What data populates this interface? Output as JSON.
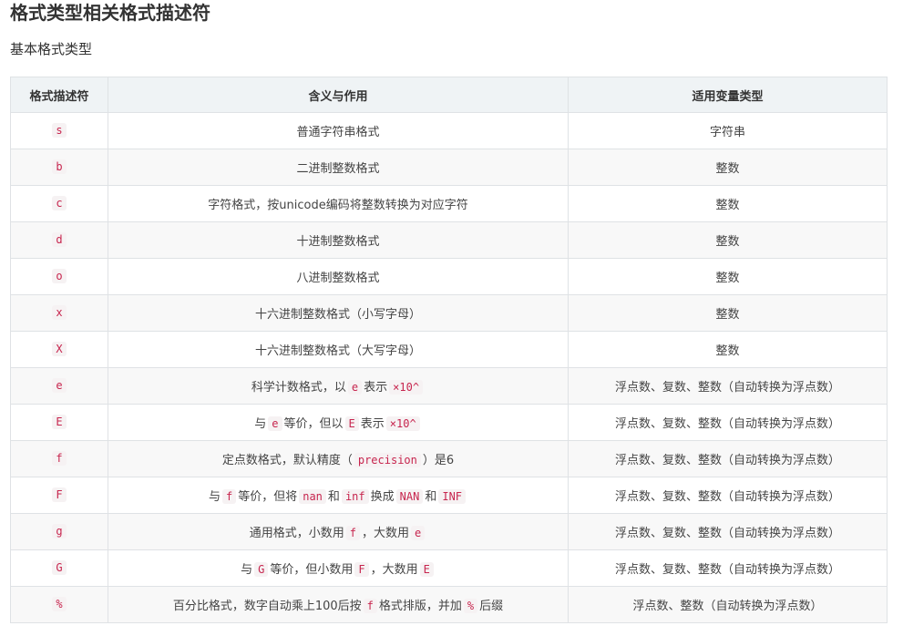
{
  "page": {
    "title": "格式类型相关格式描述符",
    "subtitle": "基本格式类型"
  },
  "table": {
    "headers": [
      "格式描述符",
      "含义与作用",
      "适用变量类型"
    ],
    "rows": [
      {
        "code": "s",
        "desc": [
          {
            "t": "普通字符串格式"
          }
        ],
        "type": "字符串"
      },
      {
        "code": "b",
        "desc": [
          {
            "t": "二进制整数格式"
          }
        ],
        "type": "整数"
      },
      {
        "code": "c",
        "desc": [
          {
            "t": "字符格式，按unicode编码将整数转换为对应字符"
          }
        ],
        "type": "整数"
      },
      {
        "code": "d",
        "desc": [
          {
            "t": "十进制整数格式"
          }
        ],
        "type": "整数"
      },
      {
        "code": "o",
        "desc": [
          {
            "t": "八进制整数格式"
          }
        ],
        "type": "整数"
      },
      {
        "code": "x",
        "desc": [
          {
            "t": "十六进制整数格式（小写字母）"
          }
        ],
        "type": "整数"
      },
      {
        "code": "X",
        "desc": [
          {
            "t": "十六进制整数格式（大写字母）"
          }
        ],
        "type": "整数"
      },
      {
        "code": "e",
        "desc": [
          {
            "t": "科学计数格式，以"
          },
          {
            "c": "e"
          },
          {
            "t": "表示"
          },
          {
            "c": "×10^"
          }
        ],
        "type": "浮点数、复数、整数（自动转换为浮点数）"
      },
      {
        "code": "E",
        "desc": [
          {
            "t": "与"
          },
          {
            "c": "e"
          },
          {
            "t": "等价，但以"
          },
          {
            "c": "E"
          },
          {
            "t": "表示"
          },
          {
            "c": "×10^"
          }
        ],
        "type": "浮点数、复数、整数（自动转换为浮点数）"
      },
      {
        "code": "f",
        "desc": [
          {
            "t": "定点数格式，默认精度（"
          },
          {
            "c": "precision"
          },
          {
            "t": "）是6"
          }
        ],
        "type": "浮点数、复数、整数（自动转换为浮点数）"
      },
      {
        "code": "F",
        "desc": [
          {
            "t": "与"
          },
          {
            "c": "f"
          },
          {
            "t": "等价，但将"
          },
          {
            "c": "nan"
          },
          {
            "t": "和"
          },
          {
            "c": "inf"
          },
          {
            "t": "换成"
          },
          {
            "c": "NAN"
          },
          {
            "t": "和"
          },
          {
            "c": "INF"
          }
        ],
        "type": "浮点数、复数、整数（自动转换为浮点数）"
      },
      {
        "code": "g",
        "desc": [
          {
            "t": "通用格式，小数用"
          },
          {
            "c": "f"
          },
          {
            "t": "，大数用"
          },
          {
            "c": "e"
          }
        ],
        "type": "浮点数、复数、整数（自动转换为浮点数）"
      },
      {
        "code": "G",
        "desc": [
          {
            "t": "与"
          },
          {
            "c": "G"
          },
          {
            "t": "等价，但小数用"
          },
          {
            "c": "F"
          },
          {
            "t": "，大数用"
          },
          {
            "c": "E"
          }
        ],
        "type": "浮点数、复数、整数（自动转换为浮点数）"
      },
      {
        "code": "%",
        "desc": [
          {
            "t": "百分比格式，数字自动乘上100后按"
          },
          {
            "c": "f"
          },
          {
            "t": "格式排版，并加"
          },
          {
            "c": "%"
          },
          {
            "t": "后缀"
          }
        ],
        "type": "浮点数、整数（自动转换为浮点数）"
      }
    ]
  }
}
